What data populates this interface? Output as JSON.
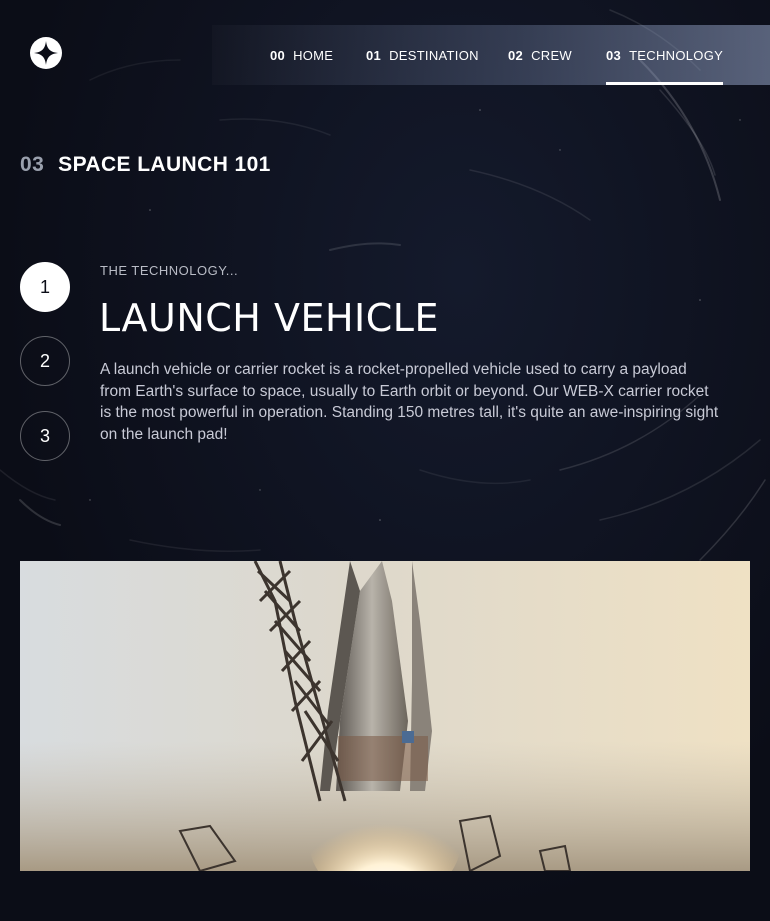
{
  "nav": {
    "items": [
      {
        "num": "00",
        "label": "HOME"
      },
      {
        "num": "01",
        "label": "DESTINATION"
      },
      {
        "num": "02",
        "label": "CREW"
      },
      {
        "num": "03",
        "label": "TECHNOLOGY"
      }
    ],
    "active_index": 3
  },
  "page": {
    "num": "03",
    "heading": "SPACE LAUNCH 101"
  },
  "stepper": {
    "steps": [
      "1",
      "2",
      "3"
    ],
    "active_index": 0
  },
  "content": {
    "eyebrow": "THE TECHNOLOGY...",
    "title": "LAUNCH VEHICLE",
    "description": "A launch vehicle or carrier rocket is a rocket-propelled vehicle used to carry a payload from Earth's surface to space, usually to Earth orbit or beyond. Our WEB-X carrier rocket is the most powerful in operation. Standing 150 metres tall, it's quite an awe-inspiring sight on the launch pad!"
  },
  "colors": {
    "background": "#0b0d17",
    "text": "#ffffff",
    "muted": "#c8cad6"
  },
  "icons": {
    "logo": "star-logo-icon"
  }
}
